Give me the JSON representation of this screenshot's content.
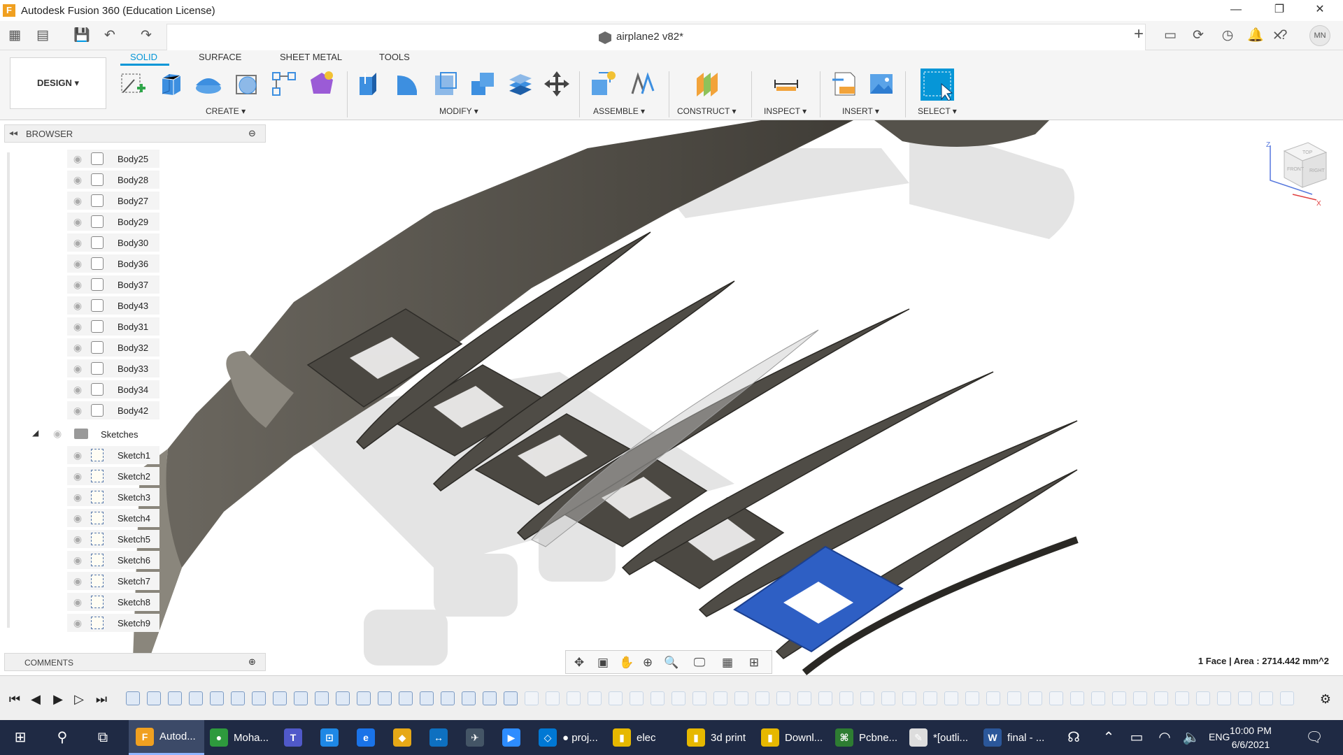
{
  "window": {
    "title": "Autodesk Fusion 360 (Education License)",
    "logo_letter": "F"
  },
  "appbar": {
    "doc_title": "airplane2 v82*",
    "user_initials": "MN"
  },
  "ribbon": {
    "workspace_label": "DESIGN",
    "tabs": [
      "SOLID",
      "SURFACE",
      "SHEET METAL",
      "TOOLS"
    ],
    "active_tab": "SOLID",
    "groups": [
      "CREATE",
      "MODIFY",
      "ASSEMBLE",
      "CONSTRUCT",
      "INSPECT",
      "INSERT",
      "SELECT"
    ]
  },
  "browser": {
    "title": "BROWSER",
    "bodies": [
      "Body25",
      "Body28",
      "Body27",
      "Body29",
      "Body30",
      "Body36",
      "Body37",
      "Body43",
      "Body31",
      "Body32",
      "Body33",
      "Body34",
      "Body42"
    ],
    "sketches_folder": "Sketches",
    "sketches": [
      "Sketch1",
      "Sketch2",
      "Sketch3",
      "Sketch4",
      "Sketch5",
      "Sketch6",
      "Sketch7",
      "Sketch8",
      "Sketch9"
    ]
  },
  "comments": {
    "label": "COMMENTS"
  },
  "viewcube": {
    "faces": [
      "TOP",
      "FRONT",
      "RIGHT"
    ],
    "axis_x": "X",
    "axis_z": "Z"
  },
  "status": {
    "selection": "1 Face | Area : 2714.442 mm^2"
  },
  "taskbar": {
    "apps": [
      {
        "label": "Autod...",
        "icon_text": "F",
        "color": "#f0a020",
        "active": true
      },
      {
        "label": "Moha...",
        "icon_text": "●",
        "color": "#2e9a3d",
        "active": false
      },
      {
        "label": "",
        "icon_text": "T",
        "color": "#5059c9",
        "active": false
      },
      {
        "label": "",
        "icon_text": "⊡",
        "color": "#1e88e5",
        "active": false
      },
      {
        "label": "",
        "icon_text": "e",
        "color": "#1a73e8",
        "active": false
      },
      {
        "label": "",
        "icon_text": "◆",
        "color": "#e6a817",
        "active": false
      },
      {
        "label": "",
        "icon_text": "↔",
        "color": "#0e70c0",
        "active": false
      },
      {
        "label": "",
        "icon_text": "✈",
        "color": "#445566",
        "active": false
      },
      {
        "label": "",
        "icon_text": "▶",
        "color": "#2d8cff",
        "active": false
      },
      {
        "label": "● proj...",
        "icon_text": "◇",
        "color": "#0078d4",
        "active": false
      },
      {
        "label": "elec",
        "icon_text": "▮",
        "color": "#e6b800",
        "active": false
      },
      {
        "label": "3d print",
        "icon_text": "▮",
        "color": "#e6b800",
        "active": false
      },
      {
        "label": "Downl...",
        "icon_text": "▮",
        "color": "#e6b800",
        "active": false
      },
      {
        "label": "Pcbne...",
        "icon_text": "⌘",
        "color": "#2e7d32",
        "active": false
      },
      {
        "label": "*[outli...",
        "icon_text": "✎",
        "color": "#dddddd",
        "active": false
      },
      {
        "label": "final - ...",
        "icon_text": "W",
        "color": "#2b579a",
        "active": false
      }
    ],
    "tray_lang": "ENG",
    "time": "10:00 PM",
    "date": "6/6/2021"
  },
  "colors": {
    "accent": "#0696d7",
    "model_gray": "#55524b",
    "selected_face": "#2e5fc4"
  }
}
